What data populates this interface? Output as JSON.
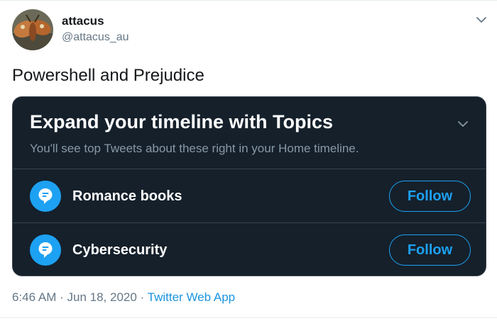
{
  "tweet": {
    "user": {
      "name": "attacus",
      "handle": "@attacus_au",
      "avatar_icon": "moth-avatar"
    },
    "text": "Powershell and Prejudice",
    "menu_icon": "chevron-down-icon",
    "time": "6:46 AM",
    "separator": "·",
    "date": "Jun 18, 2020",
    "source": "Twitter Web App"
  },
  "card": {
    "title": "Expand your timeline with Topics",
    "subtitle": "You'll see top Tweets about these right in your Home timeline.",
    "collapse_icon": "chevron-down-icon",
    "topics": [
      {
        "label": "Romance books",
        "icon": "topic-icon",
        "button": "Follow"
      },
      {
        "label": "Cybersecurity",
        "icon": "topic-icon",
        "button": "Follow"
      }
    ]
  },
  "colors": {
    "card_bg": "#15202b",
    "card_border": "#38444d",
    "accent": "#1da1f2",
    "link": "#1b95e0",
    "muted": "#657786"
  }
}
